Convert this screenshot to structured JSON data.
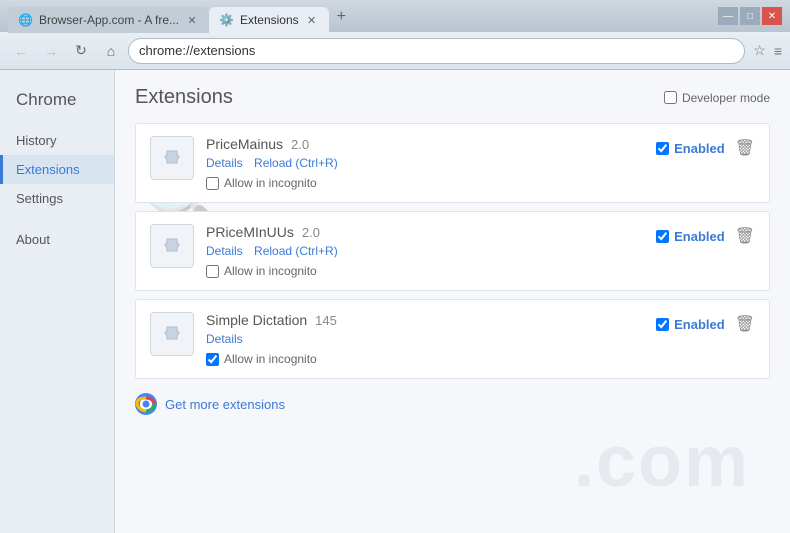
{
  "window": {
    "title_bar": {
      "tab1": {
        "label": "Browser-App.com - A fre...",
        "active": false
      },
      "tab2": {
        "label": "Extensions",
        "active": true
      },
      "controls": {
        "minimize": "—",
        "maximize": "□",
        "close": "✕"
      }
    }
  },
  "nav": {
    "back": "←",
    "forward": "→",
    "reload": "↻",
    "home": "⌂",
    "address": "chrome://extensions",
    "star": "☆",
    "menu": "≡"
  },
  "sidebar": {
    "title": "Chrome",
    "items": [
      {
        "label": "History",
        "active": false
      },
      {
        "label": "Extensions",
        "active": true
      },
      {
        "label": "Settings",
        "active": false
      },
      {
        "label": "About",
        "active": false
      }
    ]
  },
  "main": {
    "title": "Extensions",
    "developer_mode_label": "Developer mode",
    "extensions": [
      {
        "name": "PriceMainus",
        "version": "2.0",
        "enabled": true,
        "enabled_label": "Enabled",
        "details_label": "Details",
        "reload_label": "Reload (Ctrl+R)",
        "incognito_label": "Allow in incognito",
        "incognito_checked": false
      },
      {
        "name": "PRiceMInUUs",
        "version": "2.0",
        "enabled": true,
        "enabled_label": "Enabled",
        "details_label": "Details",
        "reload_label": "Reload (Ctrl+R)",
        "incognito_label": "Allow in incognito",
        "incognito_checked": false
      },
      {
        "name": "Simple Dictation",
        "version": "145",
        "enabled": true,
        "enabled_label": "Enabled",
        "details_label": "Details",
        "reload_label": null,
        "incognito_label": "Allow in incognito",
        "incognito_checked": true
      }
    ],
    "get_more_label": "Get more extensions",
    "watermark": ".com"
  }
}
